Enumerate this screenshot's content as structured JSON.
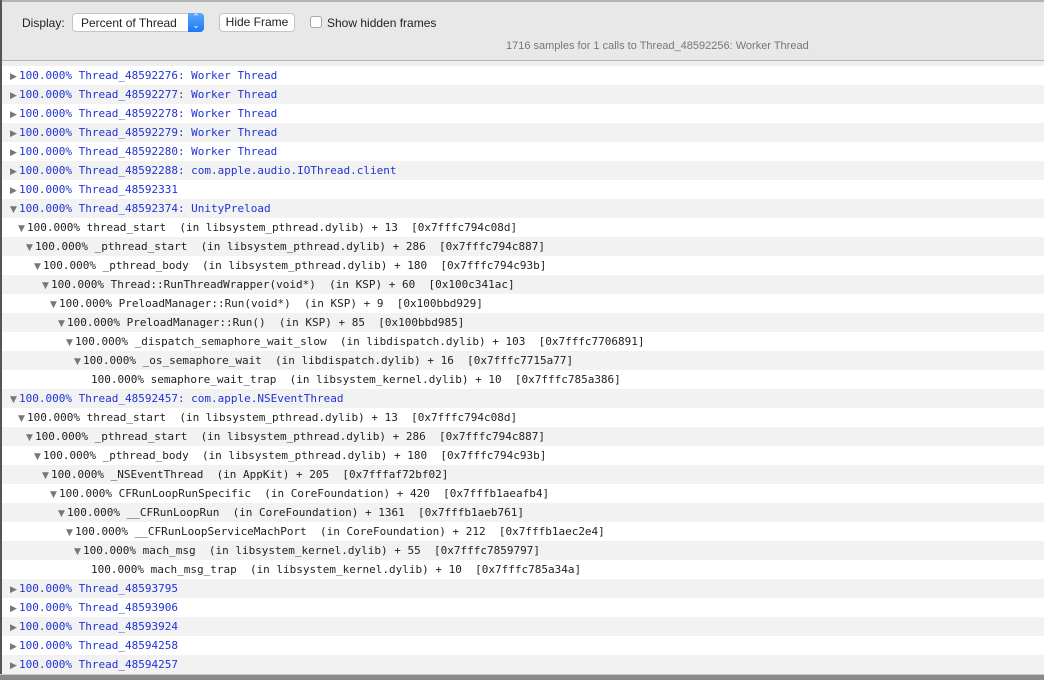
{
  "toolbar": {
    "display_label": "Display:",
    "display_value": "Percent of Thread",
    "hide_frame_label": "Hide Frame",
    "show_hidden_label": "Show hidden frames",
    "show_hidden_checked": false
  },
  "summary": "1716 samples for 1 calls to Thread_48592256: Worker Thread",
  "rows": [
    {
      "depth": 0,
      "expanded": false,
      "thread": true,
      "text": "100.000% Thread_48592276: Worker Thread"
    },
    {
      "depth": 0,
      "expanded": false,
      "thread": true,
      "text": "100.000% Thread_48592277: Worker Thread"
    },
    {
      "depth": 0,
      "expanded": false,
      "thread": true,
      "text": "100.000% Thread_48592278: Worker Thread"
    },
    {
      "depth": 0,
      "expanded": false,
      "thread": true,
      "text": "100.000% Thread_48592279: Worker Thread"
    },
    {
      "depth": 0,
      "expanded": false,
      "thread": true,
      "text": "100.000% Thread_48592280: Worker Thread"
    },
    {
      "depth": 0,
      "expanded": false,
      "thread": true,
      "text": "100.000% Thread_48592288: com.apple.audio.IOThread.client"
    },
    {
      "depth": 0,
      "expanded": false,
      "thread": true,
      "text": "100.000% Thread_48592331"
    },
    {
      "depth": 0,
      "expanded": true,
      "thread": true,
      "text": "100.000% Thread_48592374: UnityPreload"
    },
    {
      "depth": 1,
      "expanded": true,
      "thread": false,
      "text": "100.000% thread_start  (in libsystem_pthread.dylib) + 13  [0x7fffc794c08d]"
    },
    {
      "depth": 2,
      "expanded": true,
      "thread": false,
      "text": "100.000% _pthread_start  (in libsystem_pthread.dylib) + 286  [0x7fffc794c887]"
    },
    {
      "depth": 3,
      "expanded": true,
      "thread": false,
      "text": "100.000% _pthread_body  (in libsystem_pthread.dylib) + 180  [0x7fffc794c93b]"
    },
    {
      "depth": 4,
      "expanded": true,
      "thread": false,
      "text": "100.000% Thread::RunThreadWrapper(void*)  (in KSP) + 60  [0x100c341ac]"
    },
    {
      "depth": 5,
      "expanded": true,
      "thread": false,
      "text": "100.000% PreloadManager::Run(void*)  (in KSP) + 9  [0x100bbd929]"
    },
    {
      "depth": 6,
      "expanded": true,
      "thread": false,
      "text": "100.000% PreloadManager::Run()  (in KSP) + 85  [0x100bbd985]"
    },
    {
      "depth": 7,
      "expanded": true,
      "thread": false,
      "text": "100.000% _dispatch_semaphore_wait_slow  (in libdispatch.dylib) + 103  [0x7fffc7706891]"
    },
    {
      "depth": 8,
      "expanded": true,
      "thread": false,
      "text": "100.000% _os_semaphore_wait  (in libdispatch.dylib) + 16  [0x7fffc7715a77]"
    },
    {
      "depth": 9,
      "expanded": null,
      "thread": false,
      "text": "100.000% semaphore_wait_trap  (in libsystem_kernel.dylib) + 10  [0x7fffc785a386]"
    },
    {
      "depth": 0,
      "expanded": true,
      "thread": true,
      "text": "100.000% Thread_48592457: com.apple.NSEventThread"
    },
    {
      "depth": 1,
      "expanded": true,
      "thread": false,
      "text": "100.000% thread_start  (in libsystem_pthread.dylib) + 13  [0x7fffc794c08d]"
    },
    {
      "depth": 2,
      "expanded": true,
      "thread": false,
      "text": "100.000% _pthread_start  (in libsystem_pthread.dylib) + 286  [0x7fffc794c887]"
    },
    {
      "depth": 3,
      "expanded": true,
      "thread": false,
      "text": "100.000% _pthread_body  (in libsystem_pthread.dylib) + 180  [0x7fffc794c93b]"
    },
    {
      "depth": 4,
      "expanded": true,
      "thread": false,
      "text": "100.000% _NSEventThread  (in AppKit) + 205  [0x7fffaf72bf02]"
    },
    {
      "depth": 5,
      "expanded": true,
      "thread": false,
      "text": "100.000% CFRunLoopRunSpecific  (in CoreFoundation) + 420  [0x7fffb1aeafb4]"
    },
    {
      "depth": 6,
      "expanded": true,
      "thread": false,
      "text": "100.000% __CFRunLoopRun  (in CoreFoundation) + 1361  [0x7fffb1aeb761]"
    },
    {
      "depth": 7,
      "expanded": true,
      "thread": false,
      "text": "100.000% __CFRunLoopServiceMachPort  (in CoreFoundation) + 212  [0x7fffb1aec2e4]"
    },
    {
      "depth": 8,
      "expanded": true,
      "thread": false,
      "text": "100.000% mach_msg  (in libsystem_kernel.dylib) + 55  [0x7fffc7859797]"
    },
    {
      "depth": 9,
      "expanded": null,
      "thread": false,
      "text": "100.000% mach_msg_trap  (in libsystem_kernel.dylib) + 10  [0x7fffc785a34a]"
    },
    {
      "depth": 0,
      "expanded": false,
      "thread": true,
      "text": "100.000% Thread_48593795"
    },
    {
      "depth": 0,
      "expanded": false,
      "thread": true,
      "text": "100.000% Thread_48593906"
    },
    {
      "depth": 0,
      "expanded": false,
      "thread": true,
      "text": "100.000% Thread_48593924"
    },
    {
      "depth": 0,
      "expanded": false,
      "thread": true,
      "text": "100.000% Thread_48594258"
    },
    {
      "depth": 0,
      "expanded": false,
      "thread": true,
      "text": "100.000% Thread_48594257"
    }
  ]
}
